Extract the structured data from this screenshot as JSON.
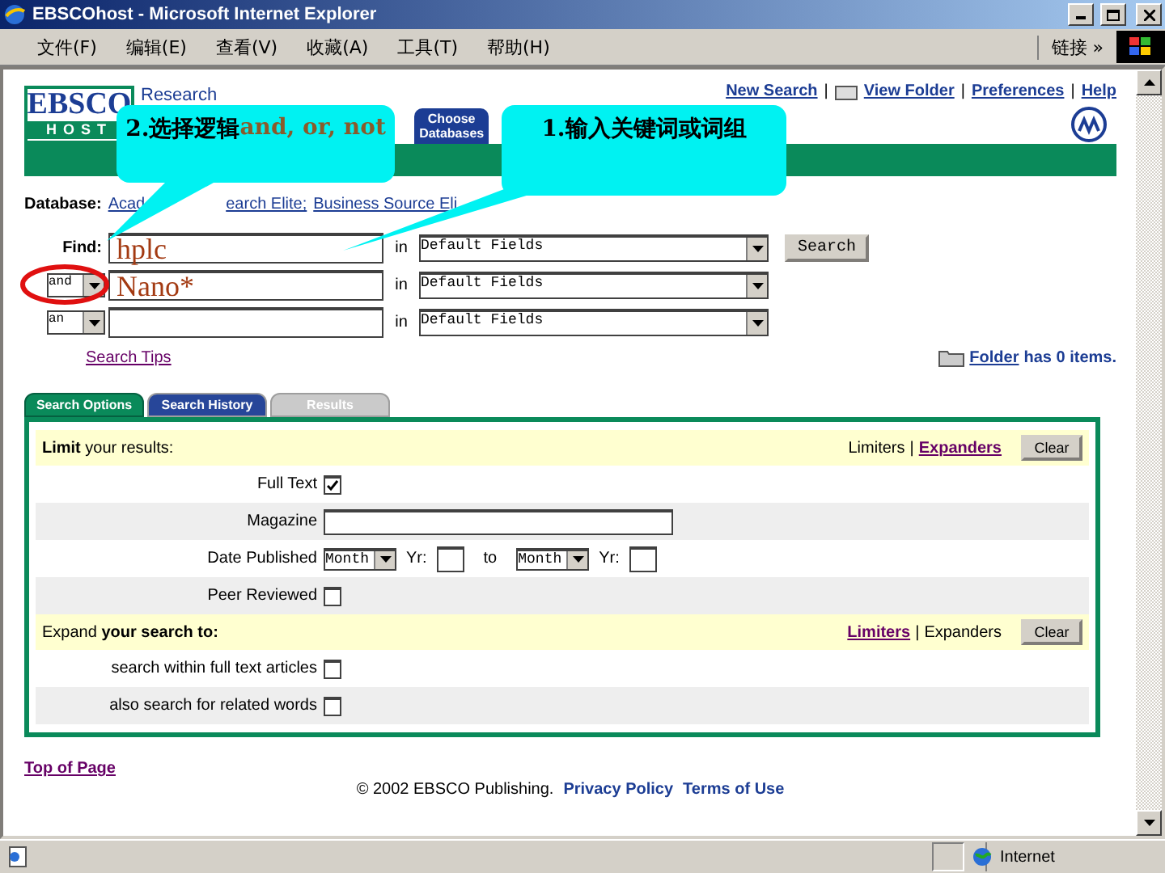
{
  "window": {
    "title": "EBSCOhost - Microsoft Internet Explorer"
  },
  "menu": [
    "文件(F)",
    "编辑(E)",
    "查看(V)",
    "收藏(A)",
    "工具(T)",
    "帮助(H)"
  ],
  "links_label": "链接 »",
  "header": {
    "logo_top": "EBSCO",
    "logo_bottom": "HOST",
    "subtitle": "Research",
    "tab": "Choose Databases",
    "nav": [
      "New Search",
      "View Folder",
      "Preferences",
      "Help"
    ],
    "separator": "|"
  },
  "database": {
    "label": "Database:",
    "links": [
      "Acad",
      "earch Elite;",
      "Business Source Eli"
    ]
  },
  "search_rows": [
    {
      "kind": "label",
      "label": "Find:",
      "value": "hplc",
      "in": "in",
      "field": "Default Fields"
    },
    {
      "kind": "operator",
      "operator": "and",
      "value": "Nano*",
      "in": "in",
      "field": "Default Fields",
      "circled": true
    },
    {
      "kind": "operator",
      "operator": "an",
      "in": "in",
      "field": "Default Fields",
      "circled": false
    }
  ],
  "search_button": "Search",
  "search_tips": "Search Tips",
  "folder": {
    "link": "Folder",
    "text": "has 0 items."
  },
  "tabs": [
    {
      "label": "Search Options",
      "selected": true,
      "color": "#0a8a5a"
    },
    {
      "label": "Search History",
      "selected": false,
      "color": "#1c3d94"
    },
    {
      "label": "Results",
      "selected": false,
      "color": "#c8c8c8"
    }
  ],
  "sections": [
    {
      "title": "**Limit** your results:",
      "switch": [
        {
          "label": "Limiters",
          "link": false
        },
        {
          "label": "Expanders",
          "link": true
        }
      ],
      "separator": "|",
      "clear": "Clear",
      "rows": [
        {
          "kind": "checkbox",
          "label": "Full Text",
          "checked": true
        },
        {
          "kind": "text",
          "label": "Magazine"
        },
        {
          "kind": "date",
          "label": "Date Published",
          "from_month": "Month",
          "from_year": "Yr:",
          "to": "to",
          "to_month": "Month",
          "to_year": "Yr:"
        },
        {
          "kind": "checkbox",
          "label": "Peer Reviewed",
          "checked": false
        }
      ]
    },
    {
      "title": "Expand **your search to:**",
      "switch": [
        {
          "label": "Limiters",
          "link": true
        },
        {
          "label": "Expanders",
          "link": false
        }
      ],
      "separator": "|",
      "clear": "Clear",
      "rows": [
        {
          "kind": "checkbox",
          "label": "search within full text articles",
          "checked": false
        },
        {
          "kind": "checkbox",
          "label": "also search for related words",
          "checked": false
        }
      ]
    }
  ],
  "footer": {
    "top_link": "Top of Page",
    "copyright": "© 2002 EBSCO Publishing.",
    "links": [
      "Privacy Policy",
      "Terms of Use"
    ]
  },
  "status_bar": {
    "zone": "Internet"
  },
  "callouts": [
    {
      "label": "2.选择逻辑",
      "highlight": "and, or, not"
    },
    {
      "label": "1.输入关键词或词组"
    }
  ]
}
